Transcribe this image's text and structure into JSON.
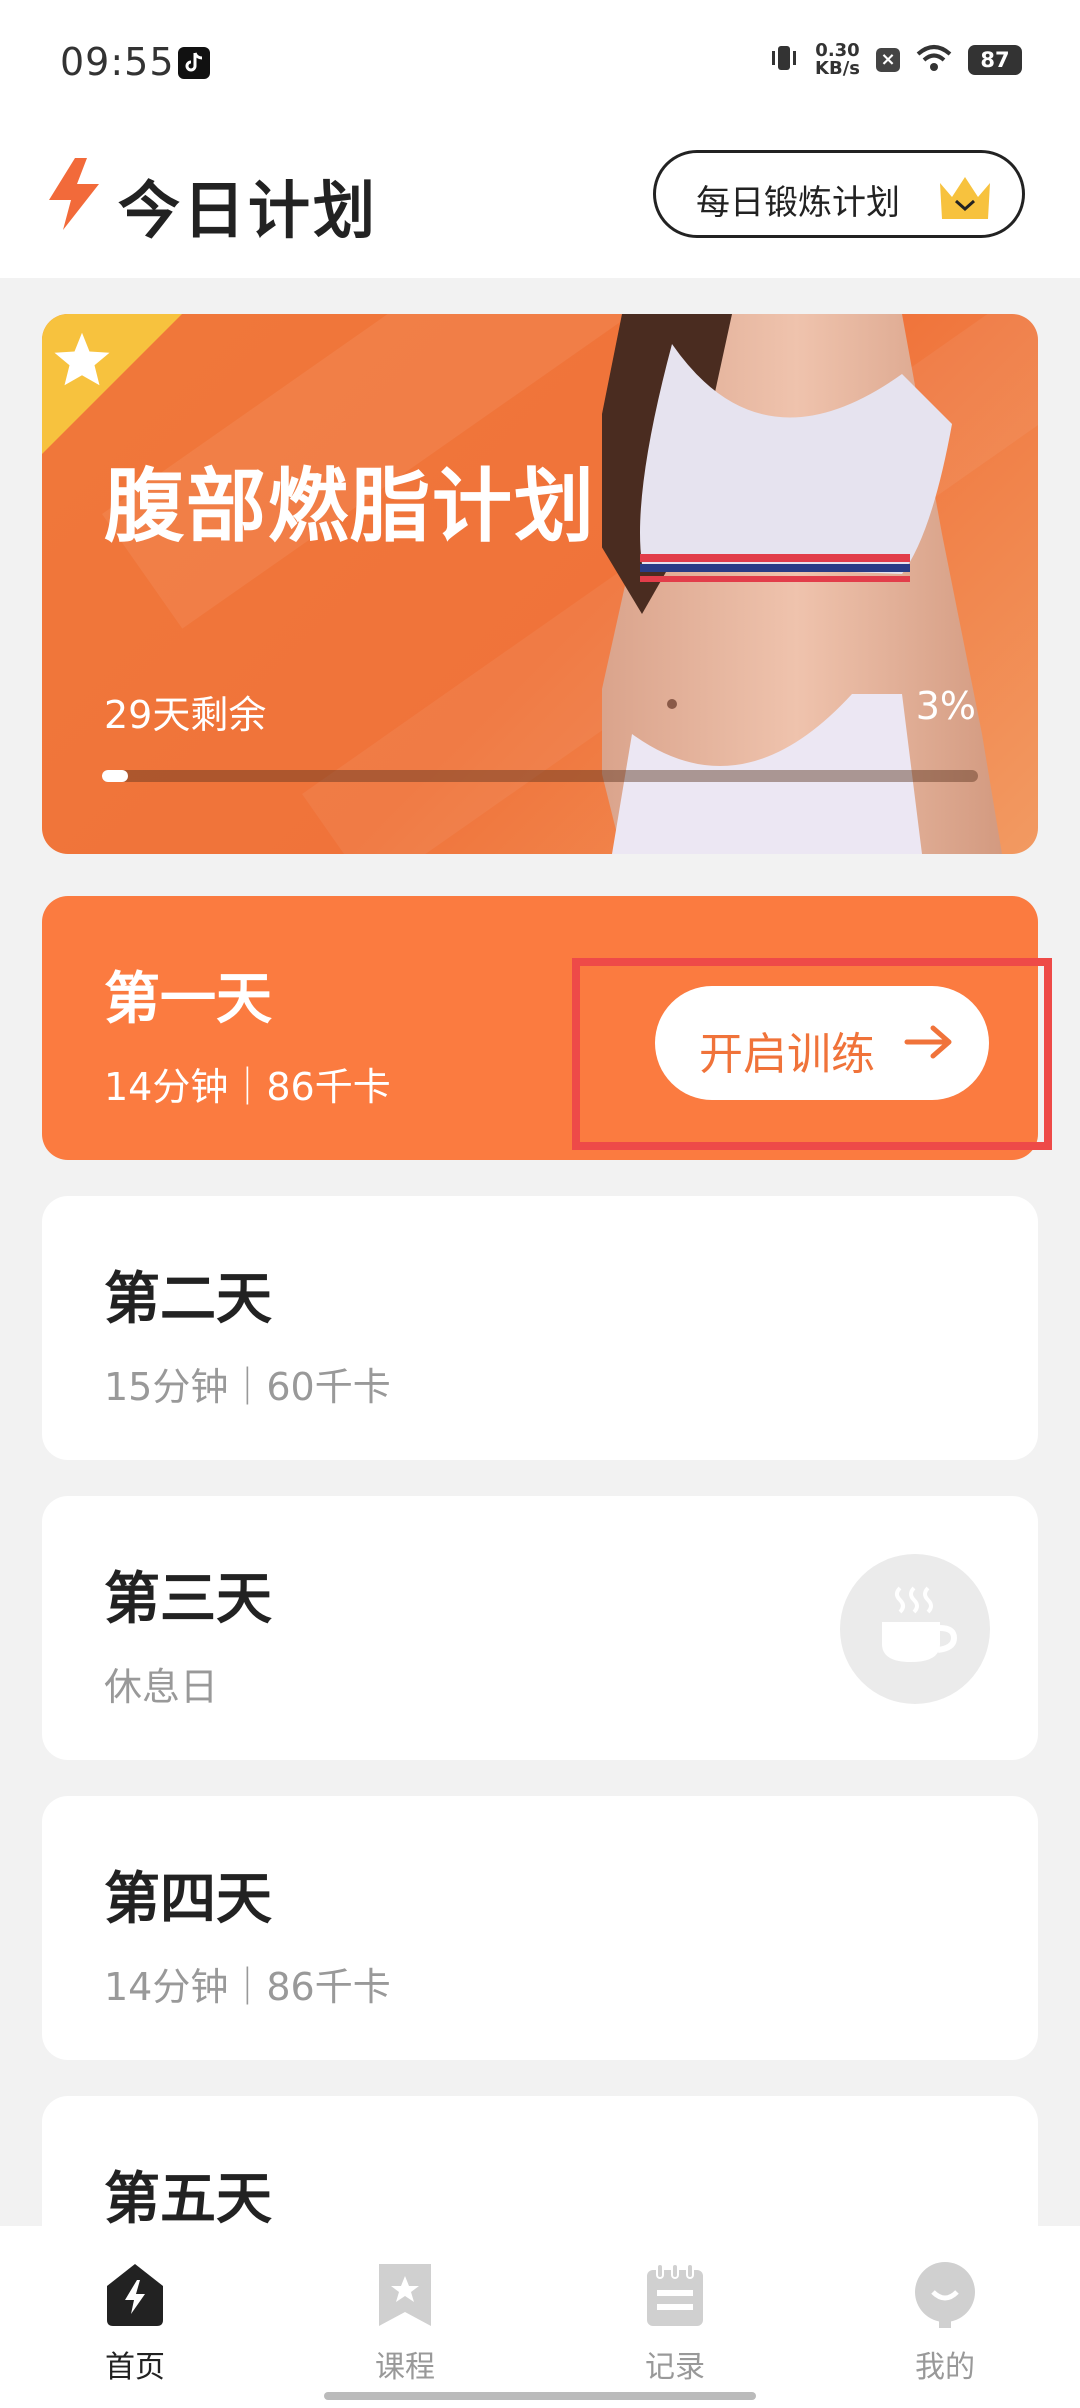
{
  "status_bar": {
    "time": "09:55",
    "net_speed_value": "0.30",
    "net_speed_unit": "KB/s",
    "battery": "87"
  },
  "header": {
    "title": "今日计划",
    "plan_button_label": "每日锻炼计划"
  },
  "hero": {
    "title": "腹部燃脂计划",
    "remaining": "29天剩余",
    "percent_text": "3%",
    "progress": 0.03
  },
  "days": [
    {
      "title": "第一天",
      "subtitle": "14分钟｜86千卡",
      "action_label": "开启训练"
    },
    {
      "title": "第二天",
      "subtitle": "15分钟｜60千卡"
    },
    {
      "title": "第三天",
      "subtitle": "休息日",
      "icon": "coffee-cup-icon"
    },
    {
      "title": "第四天",
      "subtitle": "14分钟｜86千卡"
    },
    {
      "title": "第五天",
      "subtitle": ""
    }
  ],
  "tabbar": {
    "items": [
      {
        "label": "首页",
        "icon": "home-bolt-icon",
        "active": true
      },
      {
        "label": "课程",
        "icon": "course-star-icon",
        "active": false
      },
      {
        "label": "记录",
        "icon": "record-notepad-icon",
        "active": false
      },
      {
        "label": "我的",
        "icon": "profile-icon",
        "active": false
      }
    ]
  },
  "colors": {
    "accent": "#f0733a",
    "active_card": "#fb7b40",
    "highlight": "#ee4a48",
    "star_corner": "#f7c23e"
  }
}
